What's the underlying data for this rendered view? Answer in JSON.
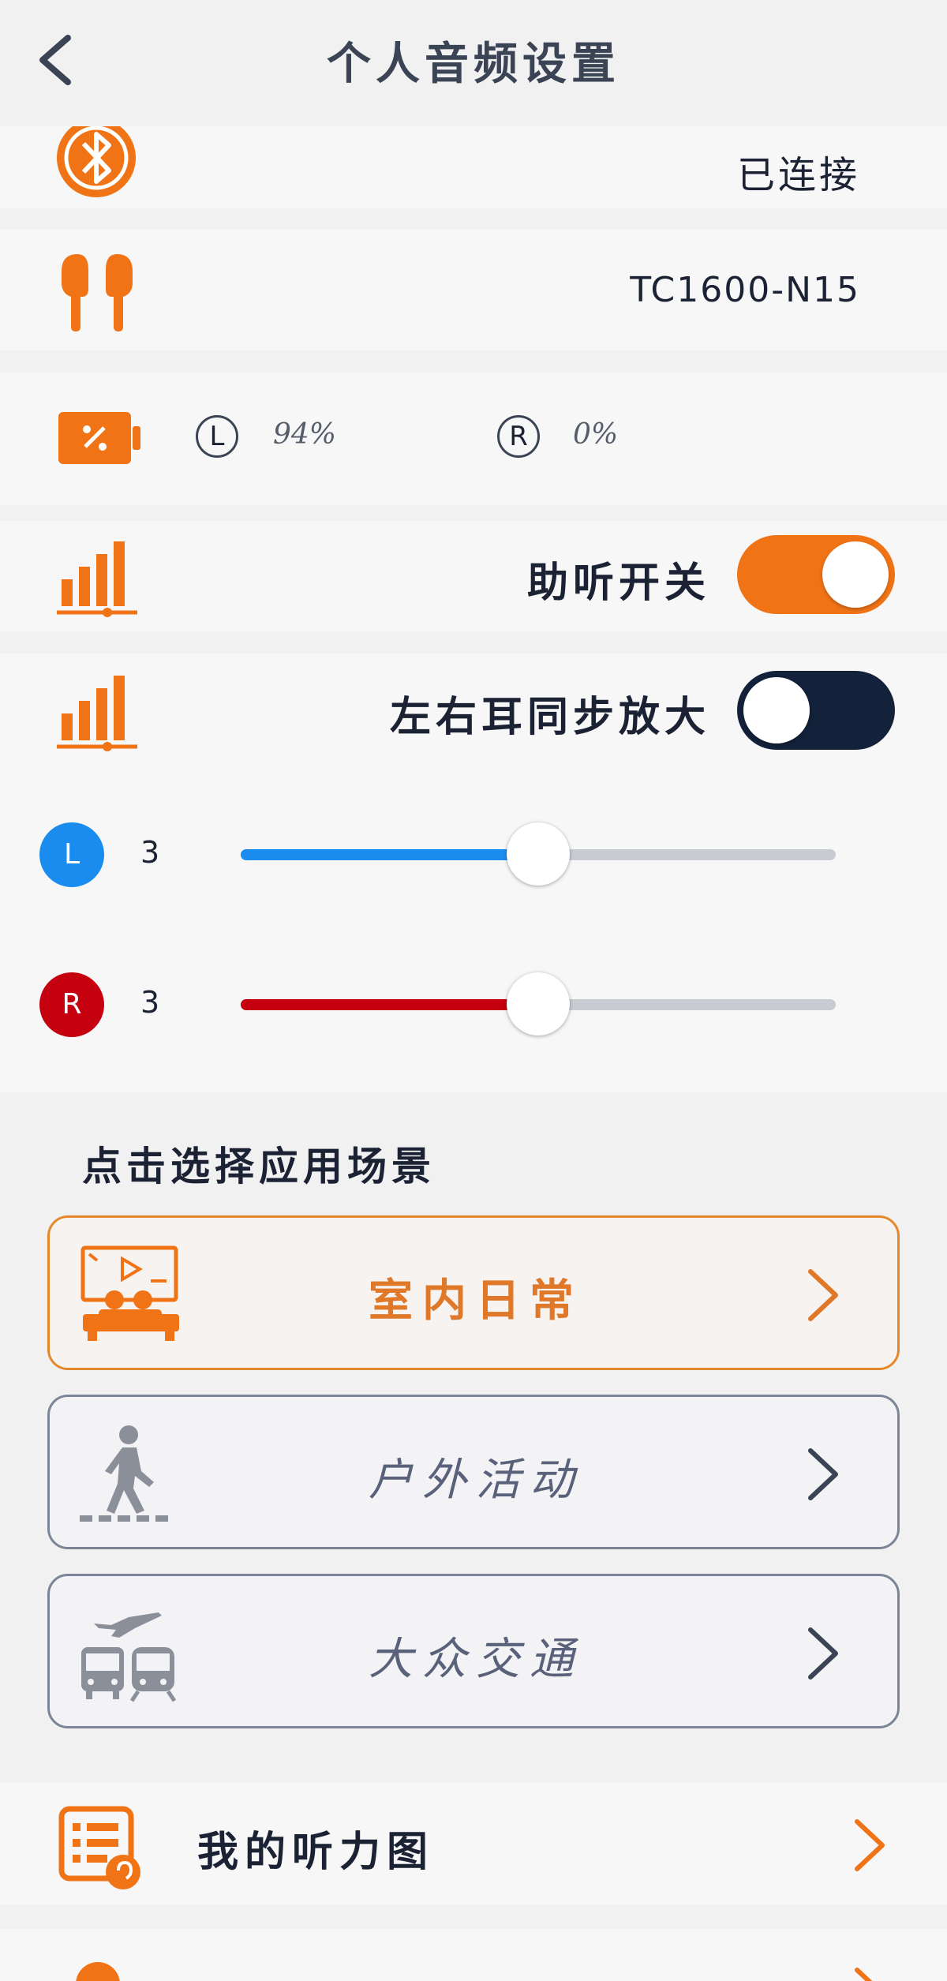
{
  "header": {
    "title": "个人音频设置",
    "back_icon": "chevron-left-icon"
  },
  "connection": {
    "icon": "bluetooth-icon",
    "status": "已连接"
  },
  "device": {
    "icon": "earbuds-icon",
    "model": "TC1600-N15"
  },
  "battery": {
    "icon": "battery-icon",
    "left_label": "L",
    "left_value": "94%",
    "right_label": "R",
    "right_value": "0%"
  },
  "hearing_aid": {
    "icon": "signal-bars-icon",
    "label": "助听开关",
    "enabled": true
  },
  "sync_amplify": {
    "icon": "signal-bars-icon",
    "label": "左右耳同步放大",
    "enabled": false
  },
  "volume": {
    "left": {
      "label": "L",
      "value": "3",
      "level_fraction": 0.5,
      "color": "#1a8cf0"
    },
    "right": {
      "label": "R",
      "value": "3",
      "level_fraction": 0.5,
      "color": "#c5000f"
    }
  },
  "scenes": {
    "heading": "点击选择应用场景",
    "items": [
      {
        "label": "室内日常",
        "icon": "indoor-tv-icon",
        "selected": true
      },
      {
        "label": "户外活动",
        "icon": "pedestrian-walking-icon",
        "selected": false
      },
      {
        "label": "大众交通",
        "icon": "transit-plane-bus-icon",
        "selected": false
      }
    ]
  },
  "hearing_map": {
    "icon": "hearing-chart-icon",
    "label": "我的听力图"
  },
  "colors": {
    "accent": "#f07316",
    "dark_toggle": "#13213a",
    "left_channel": "#1a8cf0",
    "right_channel": "#c5000f",
    "scene_selected": "#df7828"
  }
}
